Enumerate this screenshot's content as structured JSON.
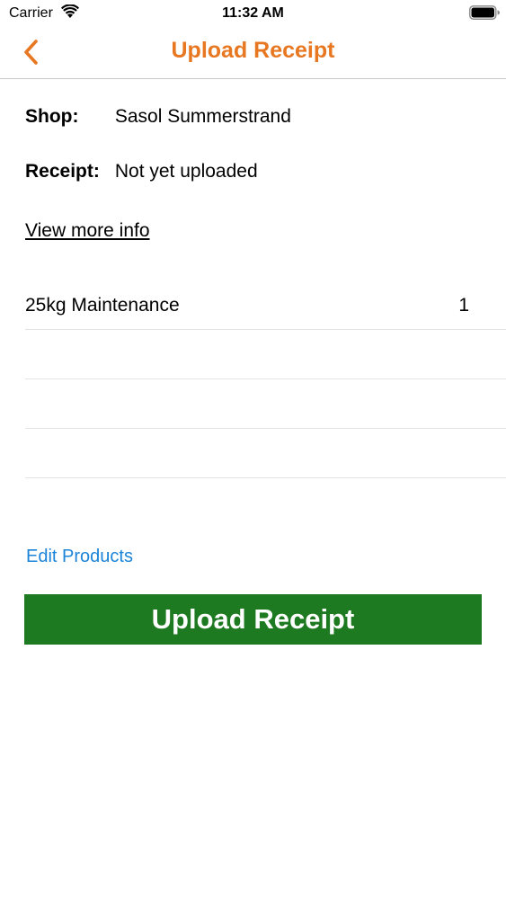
{
  "status_bar": {
    "carrier": "Carrier",
    "time": "11:32 AM",
    "wifi_icon": "wifi-icon",
    "battery_icon": "battery-full-icon"
  },
  "nav": {
    "title": "Upload Receipt",
    "back_icon": "chevron-left-icon",
    "accent_color": "#e87722"
  },
  "info": {
    "shop_label": "Shop:",
    "shop_value": "Sasol Summerstrand",
    "receipt_label": "Receipt:",
    "receipt_value": "Not yet uploaded",
    "view_more": "View more info"
  },
  "products": [
    {
      "name": "25kg Maintenance",
      "qty": "1"
    }
  ],
  "edit_products": "Edit Products",
  "upload_button": {
    "label": "Upload Receipt",
    "color": "#1e7a20"
  },
  "link_color": "#1b84d8"
}
